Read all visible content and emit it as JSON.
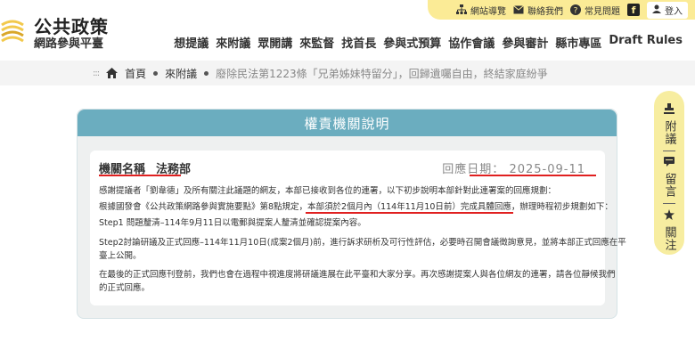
{
  "header": {
    "logo_title": "公共政策",
    "logo_subtitle": "網路參與平臺",
    "utility": [
      {
        "icon": "sitemap-icon",
        "label": "網站導覽"
      },
      {
        "icon": "mail-icon",
        "label": "聯絡我們"
      },
      {
        "icon": "question-icon",
        "label": "常見問題"
      }
    ],
    "facebook_icon": "f",
    "login_label": "登入",
    "nav": [
      "想提議",
      "來附議",
      "眾開講",
      "來監督",
      "找首長",
      "參與式預算",
      "協作會議",
      "參與審計",
      "縣市專區",
      "Draft Rules"
    ]
  },
  "breadcrumb": {
    "dots": ":::",
    "home": "首頁",
    "section": "來附議",
    "current": "廢除民法第1223條「兄弟姊妹特留分」，回歸遺囑自由，終結家庭紛爭"
  },
  "sidepanel": {
    "second": "附議",
    "comment": "留言",
    "follow": "關注"
  },
  "card": {
    "title": "權責機關說明",
    "agency_label": "機關名稱",
    "agency_name": "法務部",
    "date_label": "回應日期：",
    "date_value": "2025-09-11",
    "p1": "感謝提議者「劉韋德」及所有關注此議題的網友，本部已接收到各位的連署，以下初步說明本部針對此連署案的回應規劃：",
    "p2_a": "根據國發會《公共政策網路參與實施要點》第8點規定，",
    "p2_highlight": "本部須於2個月內（114年11月10日前）完成具體回應",
    "p2_b": "，辦理時程初步規劃如下：",
    "p3": "Step1 問題釐清–114年9月11日以電郵與提案人釐清並確認提案內容。",
    "p4_line1": "Step2討論研議及正式回應–114年11月10日(成案2個月)前，進行訴求研析及可行性評估，必要時召開會議徵詢意見，並將本部正式回應在平",
    "p4_line2": "臺上公開。",
    "p5_line1": "在最後的正式回應刊登前，我們也會在過程中視進度將研議進展在此平臺和大家分享。再次感謝提案人與各位網友的連署，請各位靜候我們",
    "p5_line2": "的正式回應。"
  },
  "colors": {
    "utility_bg": "#fbeb96",
    "card_header": "#6badbf",
    "underline": "#e02020",
    "side_bg": "#f7eda0"
  }
}
